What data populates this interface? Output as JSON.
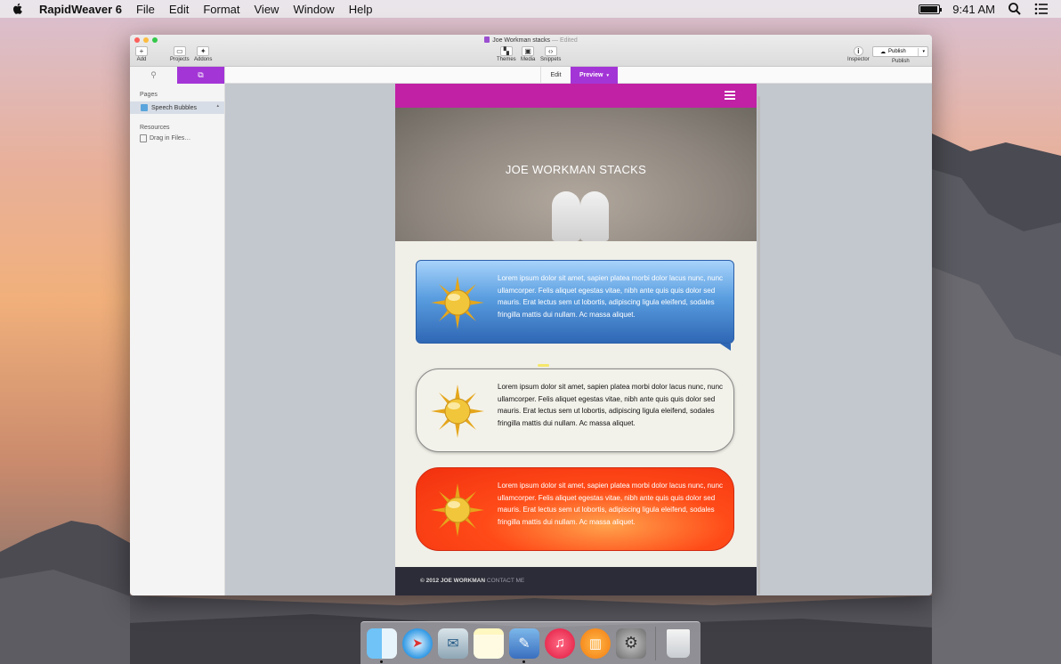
{
  "menubar": {
    "app_name": "RapidWeaver 6",
    "items": [
      "File",
      "Edit",
      "Format",
      "View",
      "Window",
      "Help"
    ],
    "clock": "9:41 AM"
  },
  "window": {
    "title": "Joe Workman stacks",
    "title_status": "— Edited",
    "toolbar": {
      "add": "Add",
      "projects": "Projects",
      "addons": "Addons",
      "themes": "Themes",
      "media": "Media",
      "snippets": "Snippets",
      "inspector": "Inspector",
      "publish_button": "Publish",
      "publish_label": "Publish"
    },
    "tabs": {
      "edit": "Edit",
      "preview": "Preview"
    }
  },
  "sidebar": {
    "pages_heading": "Pages",
    "page_item": "Speech Bubbles",
    "resources_heading": "Resources",
    "drag_files": "Drag in Files…"
  },
  "preview": {
    "hero_title": "JOE WORKMAN STACKS",
    "bubbles": [
      {
        "style": "blue",
        "text": "Lorem ipsum dolor sit amet, sapien platea morbi dolor lacus nunc, nunc ullamcorper. Felis aliquet egestas vitae, nibh ante quis quis dolor sed mauris. Erat lectus sem ut lobortis, adipiscing ligula eleifend, sodales fringilla mattis dui nullam. Ac massa aliquet."
      },
      {
        "style": "white",
        "text": "Lorem ipsum dolor sit amet, sapien platea morbi dolor lacus nunc, nunc ullamcorper. Felis aliquet egestas vitae, nibh ante quis quis dolor sed mauris. Erat lectus sem ut lobortis, adipiscing ligula eleifend, sodales fringilla mattis dui nullam. Ac massa aliquet."
      },
      {
        "style": "red",
        "text": "Lorem ipsum dolor sit amet, sapien platea morbi dolor lacus nunc, nunc ullamcorper. Felis aliquet egestas vitae, nibh ante quis quis dolor sed mauris. Erat lectus sem ut lobortis, adipiscing ligula eleifend, sodales fringilla mattis dui nullam. Ac massa aliquet."
      }
    ],
    "footer_copyright": "© 2012 JOE WORKMAN",
    "footer_contact": "CONTACT ME"
  },
  "colors": {
    "accent_purple": "#a335d6",
    "nav_magenta": "#c021a5",
    "footer_dark": "#2c2c38"
  },
  "dock": [
    "finder-icon",
    "safari-icon",
    "mail-icon",
    "notes-icon",
    "rapidweaver-icon",
    "itunes-icon",
    "ibooks-icon",
    "system-preferences-icon",
    "trash-icon"
  ]
}
